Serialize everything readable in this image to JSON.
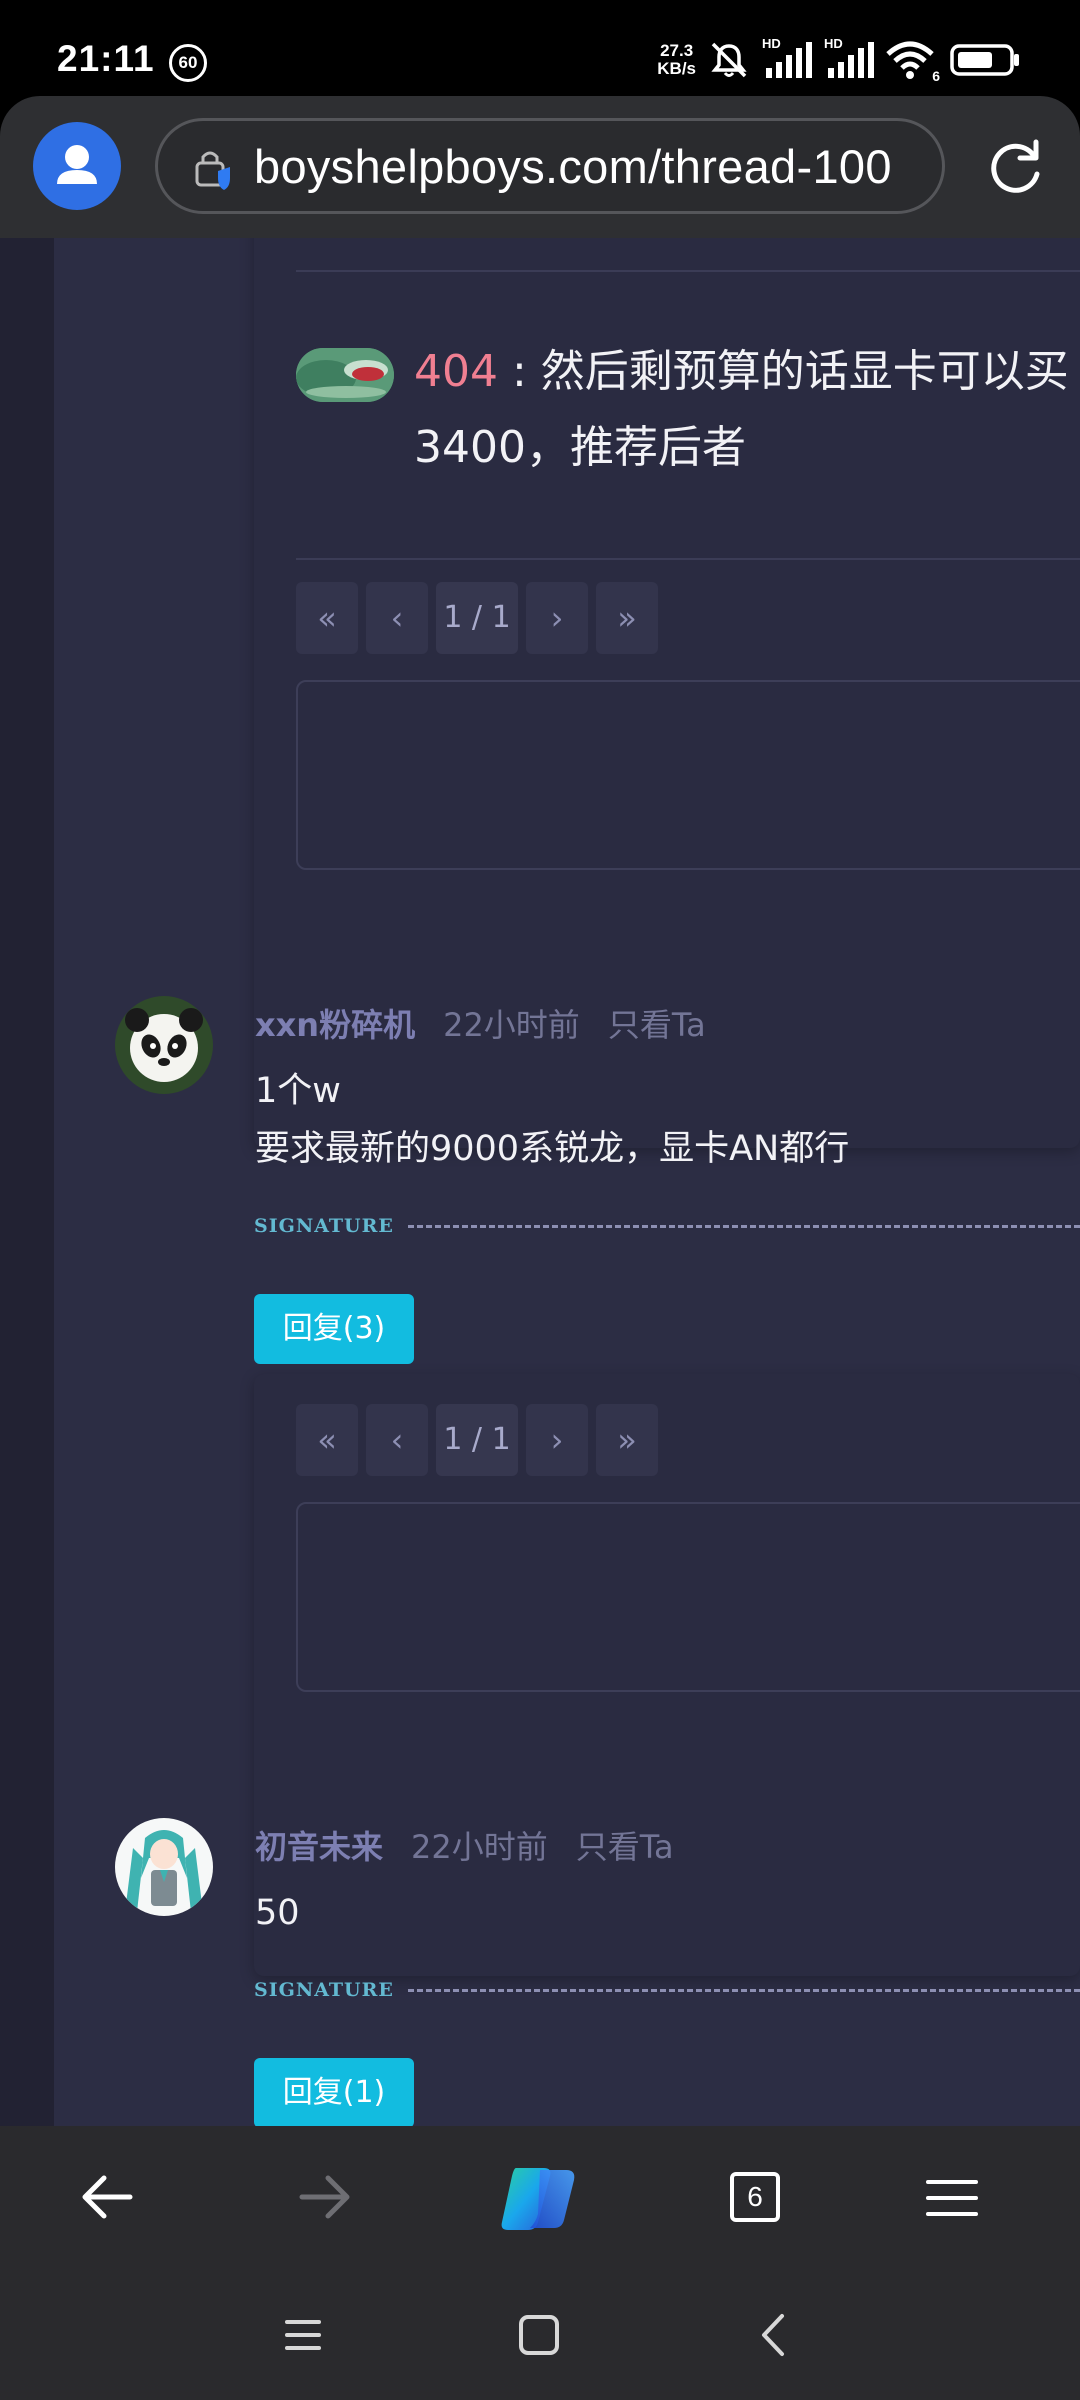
{
  "status_bar": {
    "time": "21:11",
    "badge": "60",
    "net_speed_value": "27.3",
    "net_speed_unit": "KB/s",
    "hd1": "HD",
    "hd2": "HD",
    "wifi_num": "6"
  },
  "browser": {
    "url": "boyshelpboys.com/thread-100",
    "tab_count": "6"
  },
  "reply_thread": {
    "user": "404",
    "separator": " : ",
    "line1": "然后剩预算的话显卡可以买",
    "line2": "3400，推荐后者"
  },
  "pager1": {
    "first": "«",
    "prev": "‹",
    "page": "1 / 1",
    "next": "›",
    "last": "»"
  },
  "posts": [
    {
      "author": "xxn粉碎机",
      "time": "22小时前",
      "only_ta": "只看Ta",
      "body_line1": "1个w",
      "body_line2": "要求最新的9000系锐龙，显卡AN都行",
      "signature": "SIGNATURE",
      "reply_label": "回复(3)"
    },
    {
      "author": "初音未来",
      "time": "22小时前",
      "only_ta": "只看Ta",
      "body_line1": "50",
      "signature": "SIGNATURE",
      "reply_label": "回复(1)"
    }
  ],
  "pager2": {
    "first": "«",
    "prev": "‹",
    "page": "1 / 1",
    "next": "›",
    "last": "»"
  },
  "colors": {
    "accent_button": "#12bce0",
    "username_pink": "#f07f91",
    "author_purple": "#7d7fb2",
    "page_bg": "#292a40"
  },
  "icons": [
    "profile-icon",
    "lock-shield-icon",
    "reload-icon",
    "back-arrow-icon",
    "forward-arrow-icon",
    "copilot-icon",
    "tabs-icon",
    "menu-icon",
    "recents-nav-icon",
    "home-nav-icon",
    "back-nav-icon"
  ]
}
